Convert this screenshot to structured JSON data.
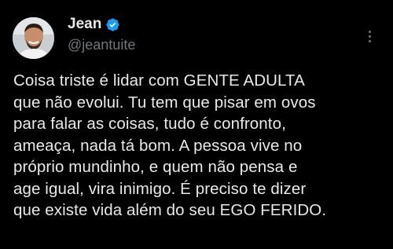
{
  "author": {
    "display_name": "Jean",
    "handle": "@jeantuite",
    "verified": true
  },
  "icons": {
    "verified": "verified-badge-icon",
    "more": "more-options-icon"
  },
  "colors": {
    "background": "#000000",
    "text": "#e7e9ea",
    "muted": "#71767b",
    "verified_badge": "#1d9bf0"
  },
  "tweet": {
    "text": "Coisa triste é lidar com GENTE ADULTA\nque não evolui. Tu tem que pisar em ovos\npara falar as coisas, tudo é confronto,\nameaça, nada tá bom. A pessoa vive no\npróprio mundinho, e quem não pensa e\nage igual, vira inimigo. É preciso te dizer\nque existe vida além do seu EGO FERIDO."
  }
}
